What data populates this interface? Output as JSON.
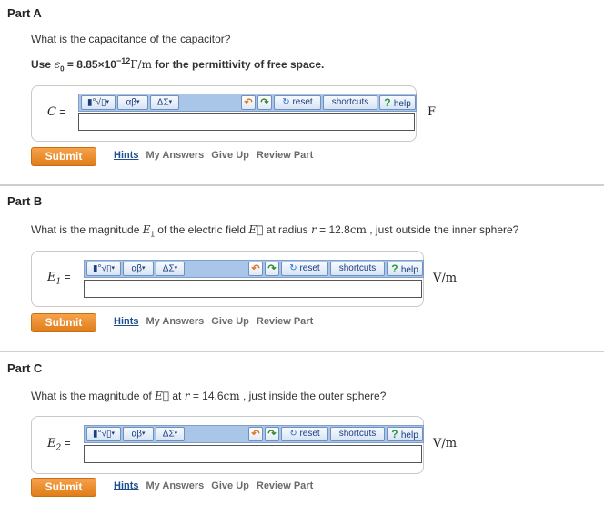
{
  "common": {
    "toolbar": {
      "template_btn": "▮°√▯",
      "greek_btn": "αβ",
      "symbols_btn": "ΔΣ",
      "reset": "reset",
      "shortcuts": "shortcuts",
      "help": "help"
    },
    "submit": "Submit",
    "links": {
      "hints": "Hints",
      "my_answers": "My Answers",
      "give_up": "Give Up",
      "review_part": "Review Part"
    }
  },
  "part_a": {
    "title": "Part A",
    "question": "What is the capacitance of the capacitor?",
    "note_prefix": "Use ",
    "note_eps": "ϵ",
    "note_sub": "0",
    "note_mid": " = 8.85×10",
    "note_exp": "−12",
    "note_unit": "F/m",
    "note_suffix": " for the permittivity of free space.",
    "var": "C",
    "eq": " =",
    "input_value": "",
    "unit": "F"
  },
  "part_b": {
    "title": "Part B",
    "q_1": "What is the magnitude ",
    "q_var": "E",
    "q_sub": "1",
    "q_2": " of the electric field ",
    "q_field": "E⃗",
    "q_3": " at radius ",
    "q_r": "r",
    "q_eq": " = ",
    "q_val": "12.8",
    "q_unit": "cm",
    "q_4": " , just outside the inner sphere?",
    "var": "E",
    "var_sub": "1",
    "eq": " =",
    "input_value": "",
    "unit": "V/m"
  },
  "part_c": {
    "title": "Part C",
    "q_1": "What is the magnitude of ",
    "q_field": "E⃗",
    "q_2": " at ",
    "q_r": "r",
    "q_eq": " = ",
    "q_val": "14.6",
    "q_unit": "cm",
    "q_3": " , just inside the outer sphere?",
    "var": "E",
    "var_sub": "2",
    "eq": " =",
    "input_value": "",
    "unit": "V/m"
  }
}
